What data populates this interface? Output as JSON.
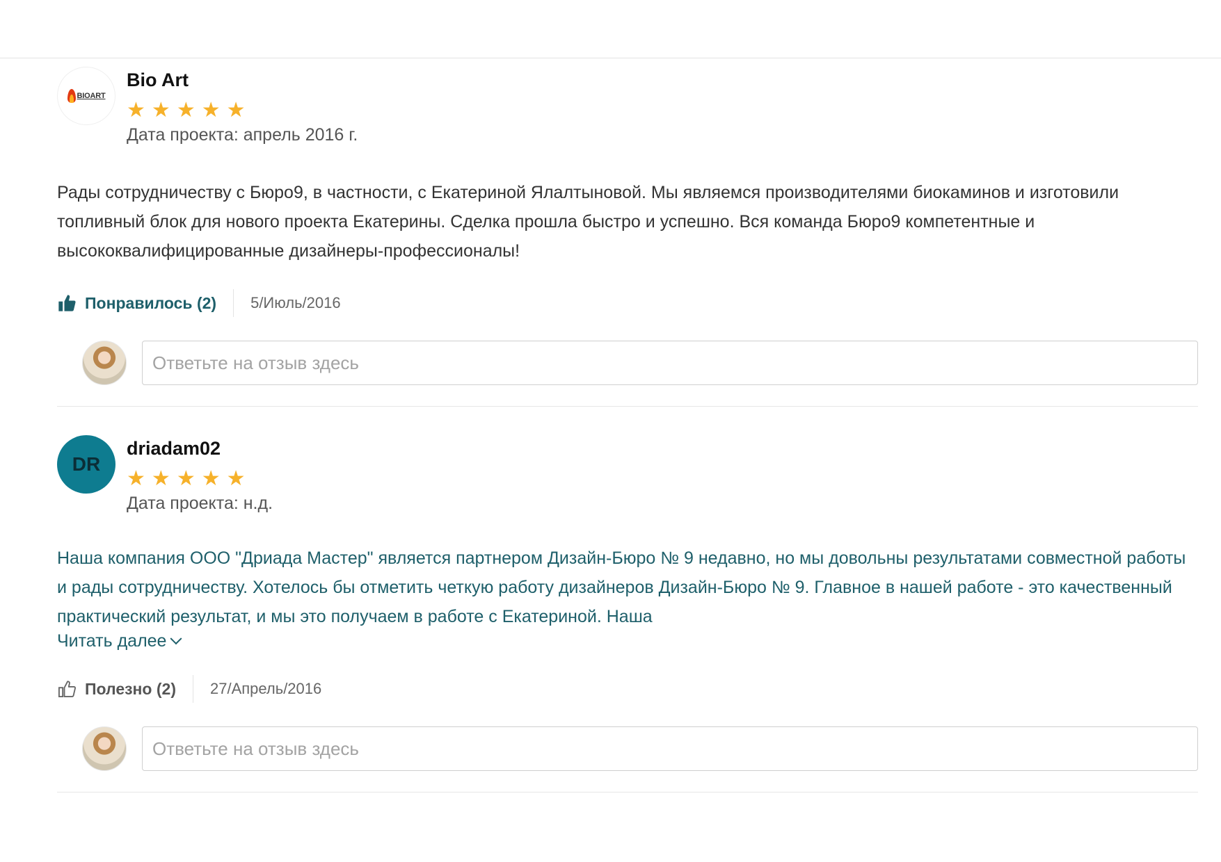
{
  "reviews": [
    {
      "avatar_logo_text": "BIOART",
      "name": "Bio Art",
      "rating": 5,
      "project_date": "Дата проекта: апрель 2016 г.",
      "text": "Рады сотрудничеству с Бюро9, в частности, с Екатериной Ялалтыновой. Мы являемся производителями биокаминов и изготовили топливный блок для нового проекта Екатерины. Сделка прошла быстро и успешно. Вся команда Бюро9 компетентные и высококвалифицированные дизайнеры-профессионалы!",
      "like_label": "Понравилось (2)",
      "date": "5/Июль/2016",
      "reply_placeholder": "Ответьте на отзыв здесь"
    },
    {
      "avatar_initials": "DR",
      "name": "driadam02",
      "rating": 5,
      "project_date": "Дата проекта: н.д.",
      "text": "Наша компания ООО \"Дриада Мастер\" является партнером Дизайн-Бюро № 9 недавно, но мы довольны результатами совместной работы и рады сотрудничеству. Хотелось бы  отметить четкую работу дизайнеров Дизайн-Бюро № 9. Главное в нашей работе - это качественный практический результат, и мы это получаем в работе с Екатериной. Наша",
      "read_more": "Читать далее",
      "like_label": "Полезно (2)",
      "date": "27/Апрель/2016",
      "reply_placeholder": "Ответьте на отзыв здесь"
    }
  ],
  "colors": {
    "star": "#f6b12a",
    "accent": "#1e5f6a",
    "avatar_initials_bg": "#0e7c90"
  },
  "icons": {
    "like_active": "thumbs-up-filled-icon",
    "like_inactive": "thumbs-up-outline-icon",
    "read_more": "chevron-down-icon",
    "star": "star-icon"
  }
}
